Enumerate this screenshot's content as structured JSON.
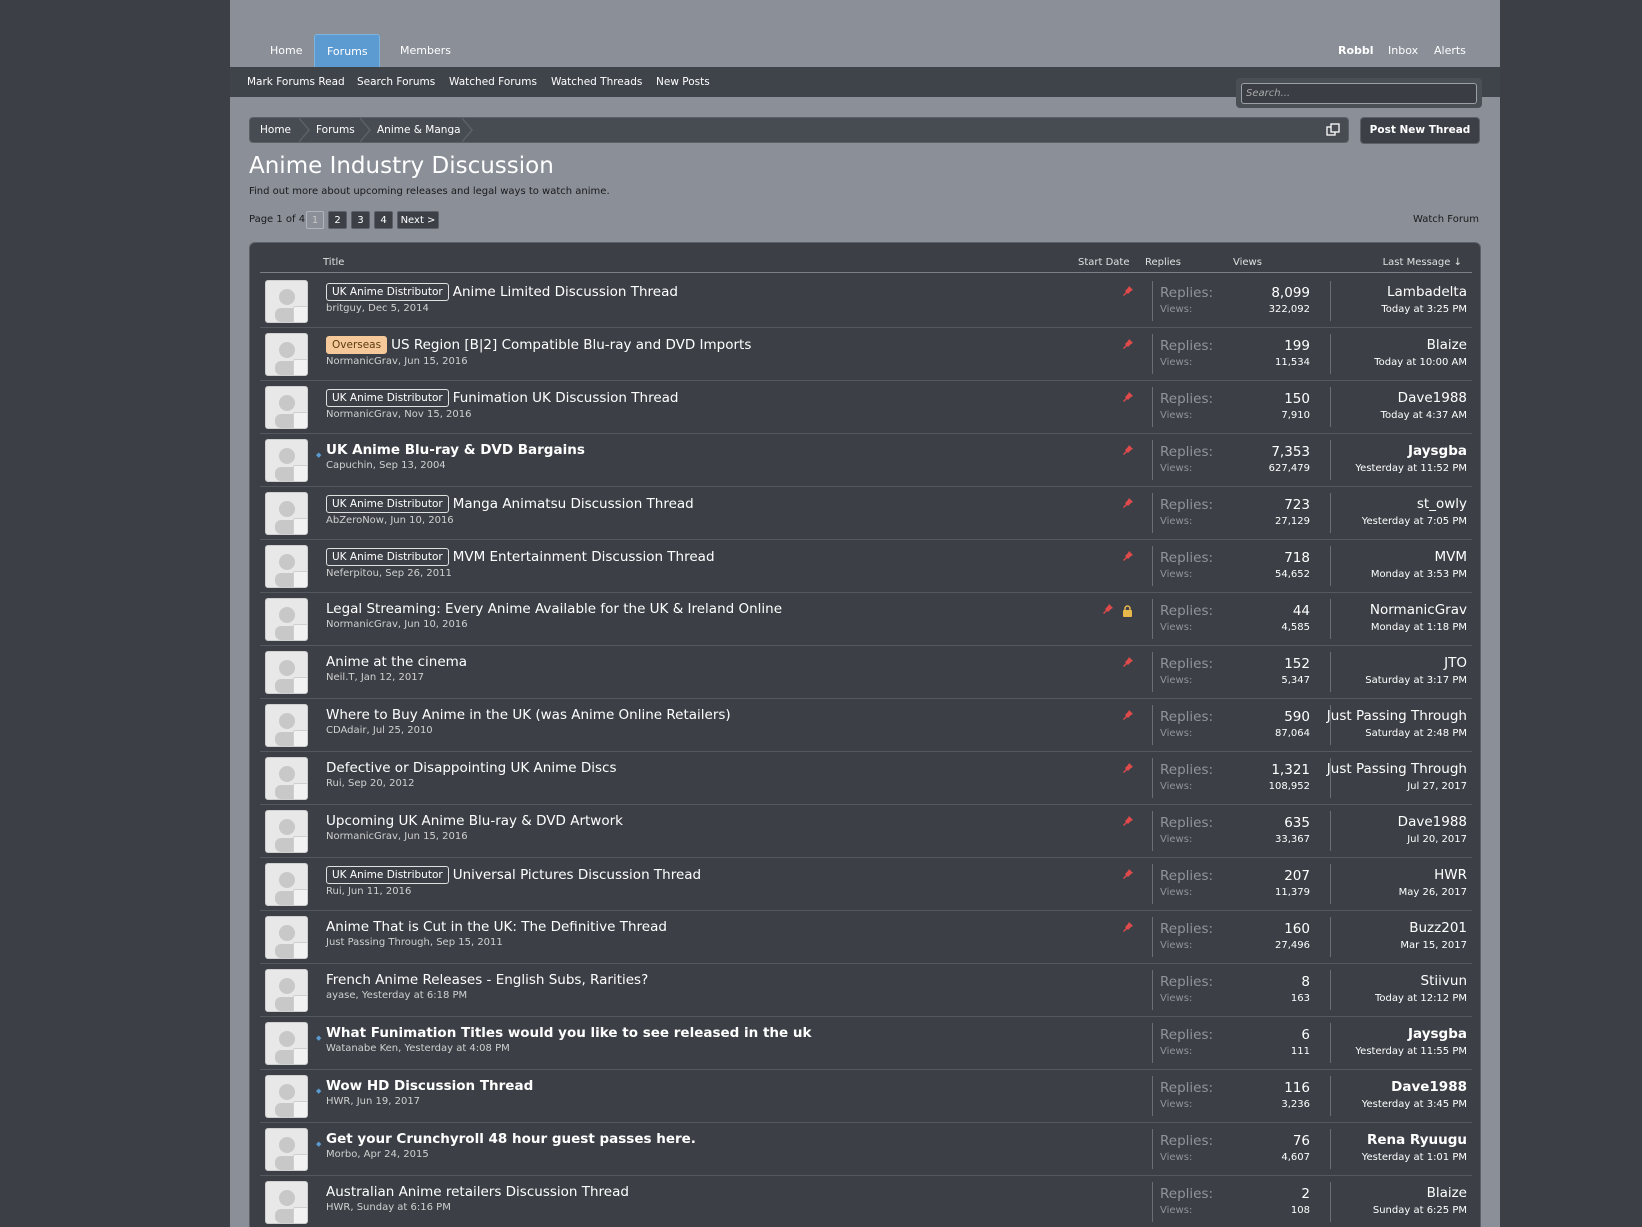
{
  "nav": {
    "tabs": [
      "Home",
      "Forums",
      "Members"
    ],
    "user": "Robbl",
    "inbox": "Inbox",
    "alerts": "Alerts"
  },
  "subnav": [
    "Mark Forums Read",
    "Search Forums",
    "Watched Forums",
    "Watched Threads",
    "New Posts"
  ],
  "search": {
    "placeholder": "Search..."
  },
  "breadcrumb": [
    "Home",
    "Forums",
    "Anime & Manga"
  ],
  "post_new_thread": "Post New Thread",
  "forum": {
    "title": "Anime Industry Discussion",
    "description": "Find out more about upcoming releases and legal ways to watch anime."
  },
  "pager": {
    "label": "Page 1 of 4",
    "pages": [
      "1",
      "2",
      "3",
      "4"
    ],
    "next": "Next >"
  },
  "watch_forum": "Watch Forum",
  "columns": {
    "title": "Title",
    "start_date": "Start Date",
    "replies": "Replies",
    "views": "Views",
    "last_message": "Last Message ↓"
  },
  "stat_labels": {
    "replies": "Replies:",
    "views": "Views:"
  },
  "colors": {
    "accent": "#5b9bd1",
    "pin": "#e04a4a",
    "lock": "#e8b84a",
    "prefix_overseas": "#f5c99a"
  },
  "threads": [
    {
      "prefix": "UK Anime Distributor",
      "title": "Anime Limited Discussion Thread",
      "meta": "britguy, Dec 5, 2014",
      "replies": "8,099",
      "views": "322,092",
      "last_user": "Lambadelta",
      "last_time": "Today at 3:25 PM",
      "pinned": true,
      "unread": false
    },
    {
      "prefix": "Overseas",
      "title": "US Region [B|2] Compatible Blu-ray and DVD Imports",
      "meta": "NormanicGrav, Jun 15, 2016",
      "replies": "199",
      "views": "11,534",
      "last_user": "Blaize",
      "last_time": "Today at 10:00 AM",
      "pinned": true,
      "unread": false
    },
    {
      "prefix": "UK Anime Distributor",
      "title": "Funimation UK Discussion Thread",
      "meta": "NormanicGrav, Nov 15, 2016",
      "replies": "150",
      "views": "7,910",
      "last_user": "Dave1988",
      "last_time": "Today at 4:37 AM",
      "pinned": true,
      "unread": false
    },
    {
      "prefix": "",
      "title": "UK Anime Blu-ray & DVD Bargains",
      "meta": "Capuchin, Sep 13, 2004",
      "replies": "7,353",
      "views": "627,479",
      "last_user": "Jaysgba",
      "last_time": "Yesterday at 11:52 PM",
      "pinned": true,
      "unread": true
    },
    {
      "prefix": "UK Anime Distributor",
      "title": "Manga Animatsu Discussion Thread",
      "meta": "AbZeroNow, Jun 10, 2016",
      "replies": "723",
      "views": "27,129",
      "last_user": "st_owly",
      "last_time": "Yesterday at 7:05 PM",
      "pinned": true,
      "unread": false
    },
    {
      "prefix": "UK Anime Distributor",
      "title": "MVM Entertainment Discussion Thread",
      "meta": "Neferpitou, Sep 26, 2011",
      "replies": "718",
      "views": "54,652",
      "last_user": "MVM",
      "last_time": "Monday at 3:53 PM",
      "pinned": true,
      "unread": false
    },
    {
      "prefix": "",
      "title": "Legal Streaming: Every Anime Available for the UK & Ireland Online",
      "meta": "NormanicGrav, Jun 10, 2016",
      "replies": "44",
      "views": "4,585",
      "last_user": "NormanicGrav",
      "last_time": "Monday at 1:18 PM",
      "pinned": true,
      "locked": true,
      "unread": false
    },
    {
      "prefix": "",
      "title": "Anime at the cinema",
      "meta": "Neil.T, Jan 12, 2017",
      "replies": "152",
      "views": "5,347",
      "last_user": "JTO",
      "last_time": "Saturday at 3:17 PM",
      "pinned": true,
      "unread": false
    },
    {
      "prefix": "",
      "title": "Where to Buy Anime in the UK (was Anime Online Retailers)",
      "meta": "CDAdair, Jul 25, 2010",
      "replies": "590",
      "views": "87,064",
      "last_user": "Just Passing Through",
      "last_time": "Saturday at 2:48 PM",
      "pinned": true,
      "unread": false
    },
    {
      "prefix": "",
      "title": "Defective or Disappointing UK Anime Discs",
      "meta": "Rui, Sep 20, 2012",
      "replies": "1,321",
      "views": "108,952",
      "last_user": "Just Passing Through",
      "last_time": "Jul 27, 2017",
      "pinned": true,
      "unread": false
    },
    {
      "prefix": "",
      "title": "Upcoming UK Anime Blu-ray & DVD Artwork",
      "meta": "NormanicGrav, Jun 15, 2016",
      "replies": "635",
      "views": "33,367",
      "last_user": "Dave1988",
      "last_time": "Jul 20, 2017",
      "pinned": true,
      "unread": false
    },
    {
      "prefix": "UK Anime Distributor",
      "title": "Universal Pictures Discussion Thread",
      "meta": "Rui, Jun 11, 2016",
      "replies": "207",
      "views": "11,379",
      "last_user": "HWR",
      "last_time": "May 26, 2017",
      "pinned": true,
      "unread": false
    },
    {
      "prefix": "",
      "title": "Anime That is Cut in the UK: The Definitive Thread",
      "meta": "Just Passing Through, Sep 15, 2011",
      "replies": "160",
      "views": "27,496",
      "last_user": "Buzz201",
      "last_time": "Mar 15, 2017",
      "pinned": true,
      "unread": false
    },
    {
      "prefix": "",
      "title": "French Anime Releases - English Subs, Rarities?",
      "meta": "ayase, Yesterday at 6:18 PM",
      "replies": "8",
      "views": "163",
      "last_user": "Stiivun",
      "last_time": "Today at 12:12 PM",
      "pinned": false,
      "unread": false
    },
    {
      "prefix": "",
      "title": "What Funimation Titles would you like to see released in the uk",
      "meta": "Watanabe Ken, Yesterday at 4:08 PM",
      "replies": "6",
      "views": "111",
      "last_user": "Jaysgba",
      "last_time": "Yesterday at 11:55 PM",
      "pinned": false,
      "unread": true
    },
    {
      "prefix": "",
      "title": "Wow HD Discussion Thread",
      "meta": "HWR, Jun 19, 2017",
      "replies": "116",
      "views": "3,236",
      "last_user": "Dave1988",
      "last_time": "Yesterday at 3:45 PM",
      "pinned": false,
      "unread": true
    },
    {
      "prefix": "",
      "title": "Get your Crunchyroll 48 hour guest passes here.",
      "meta": "Morbo, Apr 24, 2015",
      "replies": "76",
      "views": "4,607",
      "last_user": "Rena Ryuugu",
      "last_time": "Yesterday at 1:01 PM",
      "pinned": false,
      "unread": true
    },
    {
      "prefix": "",
      "title": "Australian Anime retailers Discussion Thread",
      "meta": "HWR, Sunday at 6:16 PM",
      "replies": "2",
      "views": "108",
      "last_user": "Blaize",
      "last_time": "Sunday at 6:25 PM",
      "pinned": false,
      "unread": false
    }
  ]
}
